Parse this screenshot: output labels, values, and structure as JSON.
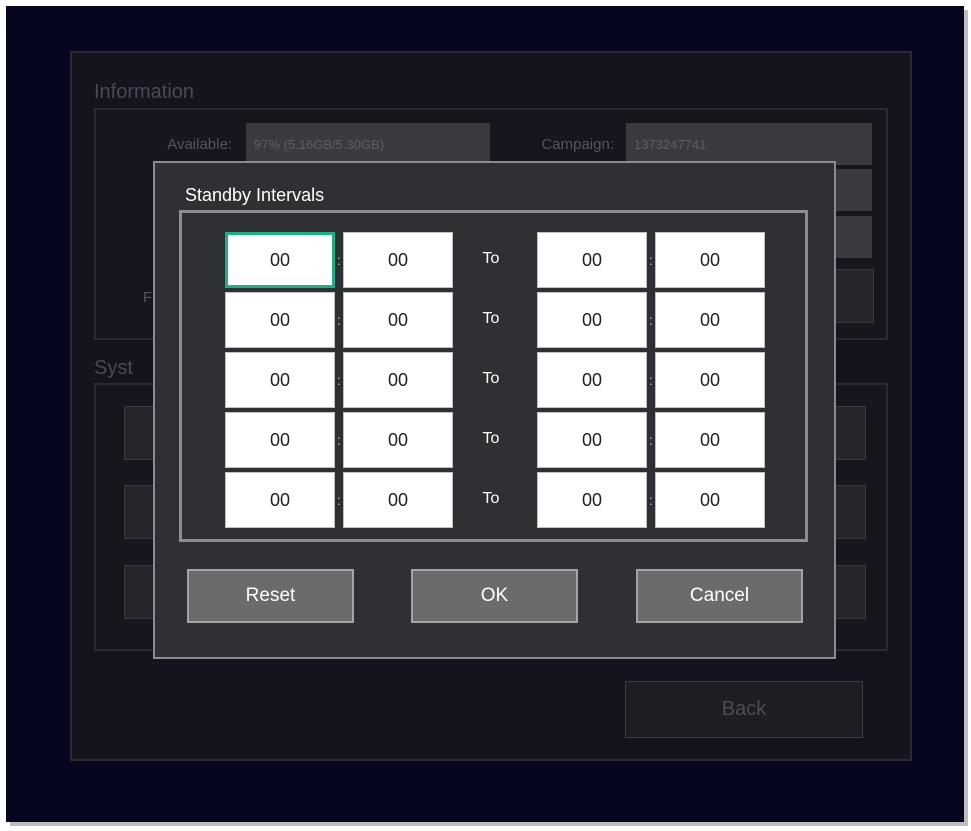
{
  "information": {
    "title": "Information",
    "available_label": "Available:",
    "available_value": "97% (5.16GB/5.30GB)",
    "campaign_label": "Campaign:",
    "campaign_value": "1373247741",
    "partial_label": "F"
  },
  "system": {
    "title": "Syst"
  },
  "back_label": "Back",
  "dialog": {
    "title": "Standby Intervals",
    "separator": ":",
    "to_label": "To",
    "rows": [
      {
        "start_hour": "00",
        "start_min": "00",
        "end_hour": "00",
        "end_min": "00"
      },
      {
        "start_hour": "00",
        "start_min": "00",
        "end_hour": "00",
        "end_min": "00"
      },
      {
        "start_hour": "00",
        "start_min": "00",
        "end_hour": "00",
        "end_min": "00"
      },
      {
        "start_hour": "00",
        "start_min": "00",
        "end_hour": "00",
        "end_min": "00"
      },
      {
        "start_hour": "00",
        "start_min": "00",
        "end_hour": "00",
        "end_min": "00"
      }
    ],
    "reset_label": "Reset",
    "ok_label": "OK",
    "cancel_label": "Cancel"
  },
  "colors": {
    "focus_accent": "#1fae8a",
    "dialog_bg": "#2e3034",
    "screen_bg": "#06061e"
  }
}
